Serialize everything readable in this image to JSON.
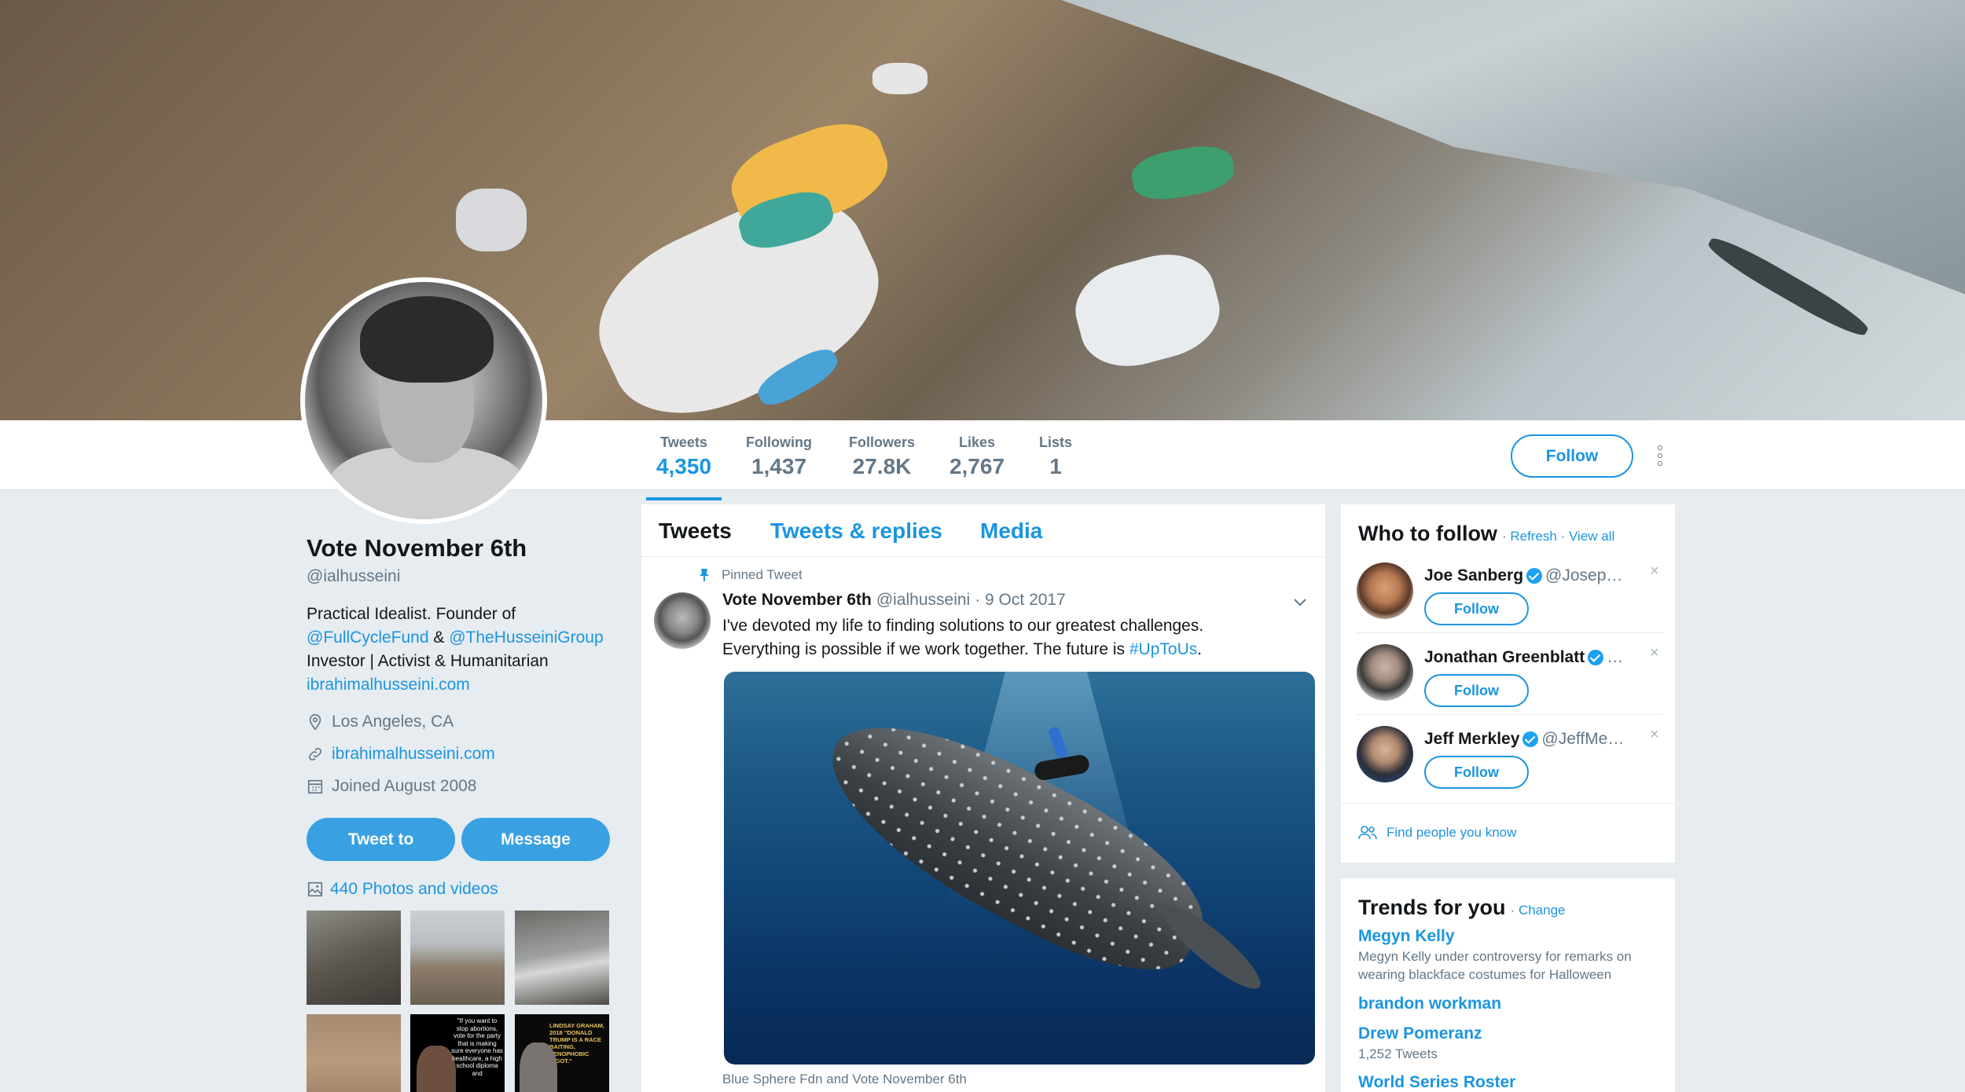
{
  "stats": [
    {
      "label": "Tweets",
      "value": "4,350"
    },
    {
      "label": "Following",
      "value": "1,437"
    },
    {
      "label": "Followers",
      "value": "27.8K"
    },
    {
      "label": "Likes",
      "value": "2,767"
    },
    {
      "label": "Lists",
      "value": "1"
    }
  ],
  "header": {
    "follow_label": "Follow"
  },
  "profile": {
    "name": "Vote November 6th",
    "handle": "@ialhusseini",
    "bio_line1": "Practical Idealist. Founder of",
    "bio_link1": "@FullCycleFund",
    "bio_amp": " & ",
    "bio_link2": "@TheHusseiniGroup",
    "bio_line3": "Investor | Activist & Humanitarian",
    "bio_url": "ibrahimalhusseini.com",
    "location": "Los Angeles, CA",
    "website": "ibrahimalhusseini.com",
    "joined": "Joined August 2008",
    "tweet_to_label": "Tweet to",
    "message_label": "Message",
    "photos_label": "440 Photos and videos"
  },
  "timeline": {
    "tabs": [
      "Tweets",
      "Tweets & replies",
      "Media"
    ],
    "pinned_label": "Pinned Tweet",
    "tweet": {
      "name": "Vote November 6th",
      "handle": "@ialhusseini",
      "date": "· 9 Oct 2017",
      "text_line1": "I've devoted my life to finding solutions to our greatest challenges.",
      "text_line2": "Everything is possible if we work together. The future is ",
      "hashtag": "#UpToUs",
      "text_end": ".",
      "caption": "Blue Sphere Fdn and Vote November 6th"
    }
  },
  "who_to_follow": {
    "title": "Who to follow",
    "refresh": "Refresh",
    "view_all": "View all",
    "sep": "·",
    "follow_label": "Follow",
    "find_people": "Find people you know",
    "accounts": [
      {
        "name": "Joe Sanberg",
        "handle": "@Josep…"
      },
      {
        "name": "Jonathan Greenblatt",
        "handle": "…"
      },
      {
        "name": "Jeff Merkley",
        "handle": "@JeffMe…"
      }
    ]
  },
  "trends": {
    "title": "Trends for you",
    "change": "Change",
    "sep": "·",
    "items": [
      {
        "name": "Megyn Kelly",
        "desc": "Megyn Kelly under controversy for remarks on wearing blackface costumes for Halloween"
      },
      {
        "name": "brandon workman",
        "desc": ""
      },
      {
        "name": "Drew Pomeranz",
        "desc": "1,252 Tweets"
      },
      {
        "name": "World Series Roster",
        "desc": ""
      }
    ]
  },
  "thumb_text": {
    "t5": "\"If you want to stop abortions, vote for the party that is making sure everyone has healthcare, a high school diploma and",
    "t6": "LINDSAY GRAHAM, 2018 \"DONALD TRUMP IS A RACE BAITING, XENOPHOBIC BIGOT.\""
  },
  "colors": {
    "accent": "#1b95e0",
    "background": "#e6ecf0"
  }
}
